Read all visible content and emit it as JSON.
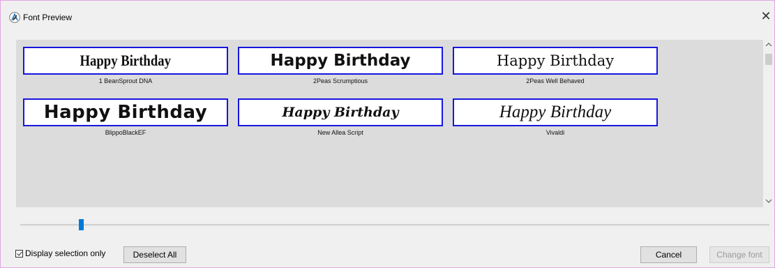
{
  "window": {
    "title": "Font Preview",
    "close_glyph": "✕"
  },
  "fonts": [
    {
      "sample": "Happy Birthday",
      "name": "1 BeanSprout DNA"
    },
    {
      "sample": "Happy Birthday",
      "name": "2Peas Scrumptious"
    },
    {
      "sample": "Happy Birthday",
      "name": "2Peas Well Behaved"
    },
    {
      "sample": "Happy Birthday",
      "name": "BlippoBlackEF"
    },
    {
      "sample": "Happy Birthday",
      "name": "New Allea Script"
    },
    {
      "sample": "Happy Birthday",
      "name": "Vivaldi"
    }
  ],
  "footer": {
    "display_selection_label": "Display selection only",
    "display_selection_checked": true,
    "deselect_label": "Deselect All",
    "cancel_label": "Cancel",
    "change_font_label": "Change font"
  },
  "colors": {
    "tile_border": "#1616e0",
    "grid_background": "#dcdcdc",
    "slider_thumb": "#0078d7"
  },
  "icons": {
    "app": "app-logo-icon",
    "close": "close-icon",
    "scroll_up": "chevron-up-icon",
    "scroll_down": "chevron-down-icon"
  }
}
